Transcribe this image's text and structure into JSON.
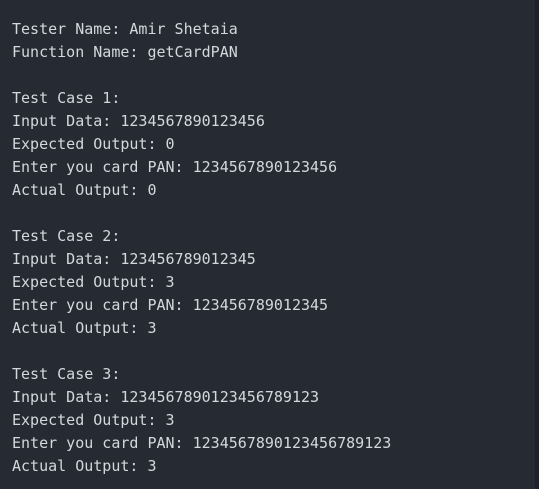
{
  "header": {
    "tester": "Tester Name: Amir Shetaia",
    "function": "Function Name: getCardPAN"
  },
  "cases": [
    {
      "title": "Test Case 1:",
      "input": "Input Data: 1234567890123456",
      "expected": "Expected Output: 0",
      "prompt": "Enter you card PAN: 1234567890123456",
      "actual": "Actual Output: 0"
    },
    {
      "title": "Test Case 2:",
      "input": "Input Data: 123456789012345",
      "expected": "Expected Output: 3",
      "prompt": "Enter you card PAN: 123456789012345",
      "actual": "Actual Output: 3"
    },
    {
      "title": "Test Case 3:",
      "input": "Input Data: 1234567890123456789123",
      "expected": "Expected Output: 3",
      "prompt": "Enter you card PAN: 1234567890123456789123",
      "actual": "Actual Output: 3"
    }
  ]
}
